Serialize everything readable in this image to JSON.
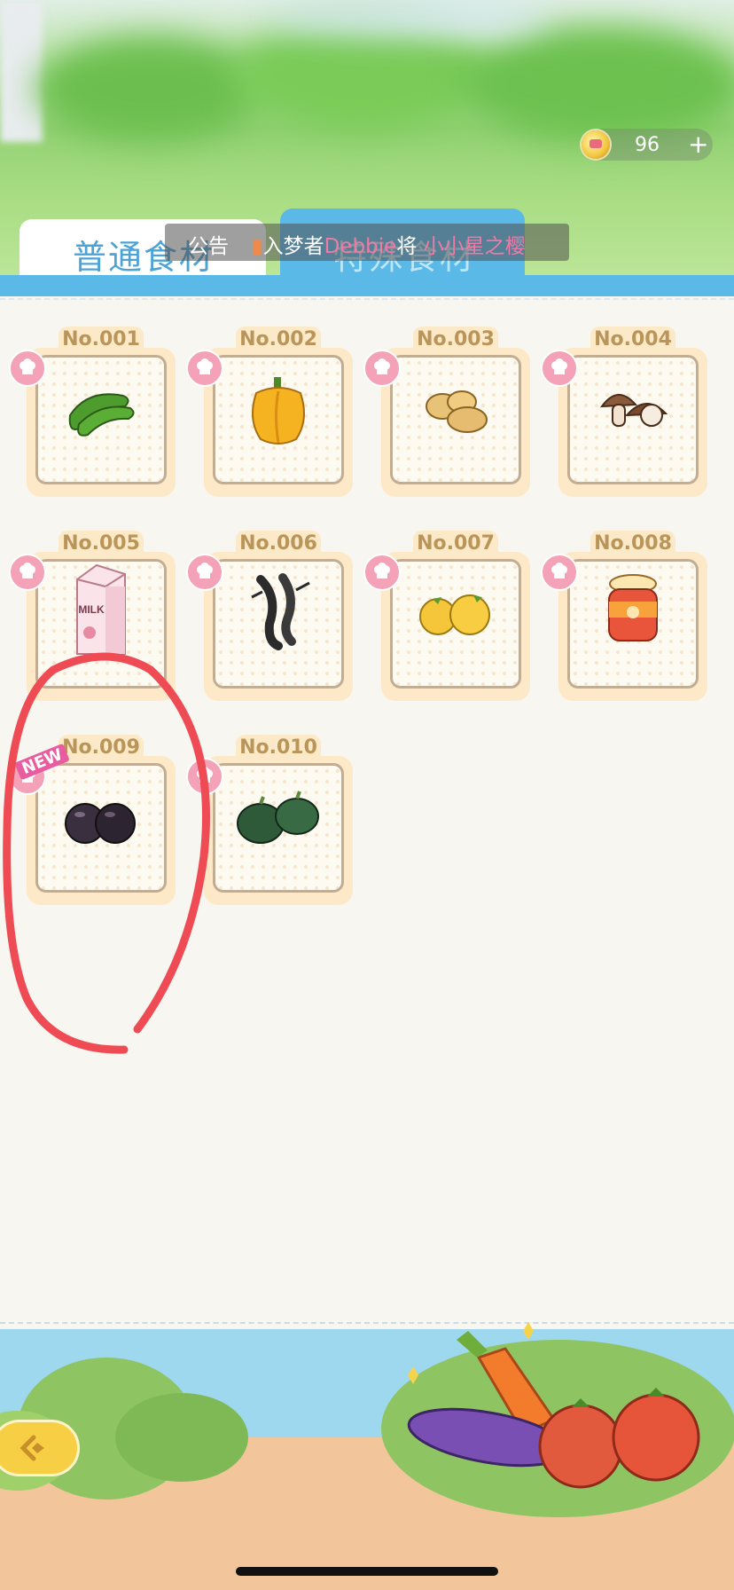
{
  "currency": {
    "value": "96",
    "plus": "+",
    "icon": "coin-icon"
  },
  "tabs": [
    {
      "label": "普通食材",
      "selected": true
    },
    {
      "label": "特殊食材",
      "selected": false
    }
  ],
  "announcement": {
    "label": "公告",
    "prefix": "入梦者",
    "user": "Debbie",
    "verb": "将",
    "target": "小小星之樱"
  },
  "items": [
    {
      "num": "No.001",
      "food": "green-pepper"
    },
    {
      "num": "No.002",
      "food": "yellow-bell-pepper"
    },
    {
      "num": "No.003",
      "food": "potatoes"
    },
    {
      "num": "No.004",
      "food": "mushrooms"
    },
    {
      "num": "No.005",
      "food": "milk-carton",
      "text": "MILK"
    },
    {
      "num": "No.006",
      "food": "black-shrimp"
    },
    {
      "num": "No.007",
      "food": "lemons"
    },
    {
      "num": "No.008",
      "food": "jam-jar"
    },
    {
      "num": "No.009",
      "food": "black-plums",
      "new": "NEW"
    },
    {
      "num": "No.010",
      "food": "green-pumpkins"
    }
  ],
  "colors": {
    "tab_blue": "#5ab9e6",
    "badge_pink": "#f4a2b7",
    "annotation_red": "#ef4b55"
  }
}
